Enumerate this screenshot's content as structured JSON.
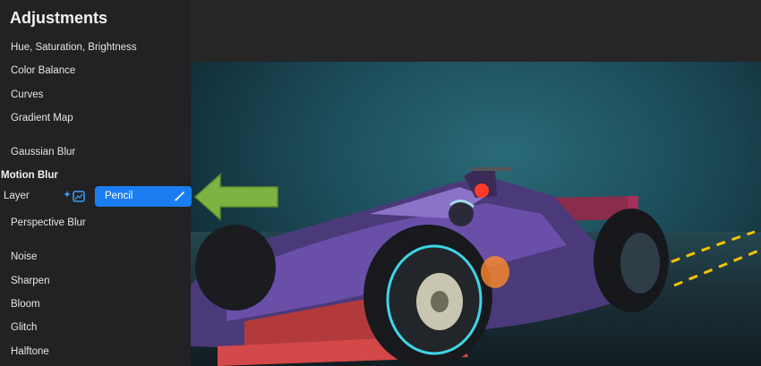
{
  "panel": {
    "title": "Adjustments",
    "items": [
      "Hue, Saturation, Brightness",
      "Color Balance",
      "Curves",
      "Gradient Map",
      "Gaussian Blur",
      "Perspective Blur",
      "Noise",
      "Sharpen",
      "Bloom",
      "Glitch",
      "Halftone"
    ],
    "section": "Motion Blur",
    "modes": {
      "layer_label": "Layer",
      "pencil_label": "Pencil",
      "selected": "Pencil"
    }
  },
  "colors": {
    "accent": "#1a7ef2",
    "arrow": "#7cb342"
  }
}
